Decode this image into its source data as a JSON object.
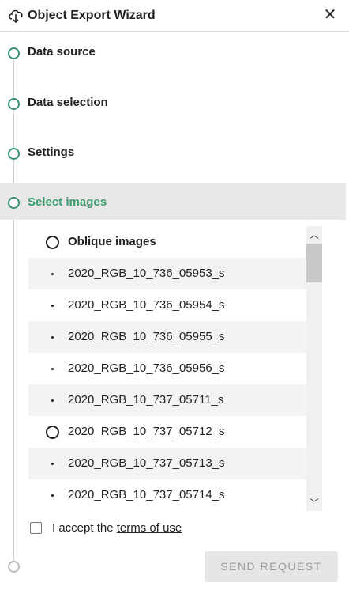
{
  "header": {
    "title": "Object Export Wizard",
    "icon": "download-cloud-icon",
    "close_label": "✕"
  },
  "steps": [
    {
      "label": "Data source"
    },
    {
      "label": "Data selection"
    },
    {
      "label": "Settings"
    },
    {
      "label": "Select images"
    }
  ],
  "image_list": {
    "group": "Oblique images",
    "items": [
      "2020_RGB_10_736_05953_s",
      "2020_RGB_10_736_05954_s",
      "2020_RGB_10_736_05955_s",
      "2020_RGB_10_736_05956_s",
      "2020_RGB_10_737_05711_s",
      "2020_RGB_10_737_05712_s",
      "2020_RGB_10_737_05713_s",
      "2020_RGB_10_737_05714_s"
    ]
  },
  "scroll": {
    "up": "︿",
    "down": "﹀"
  },
  "terms": {
    "prefix": "I accept the ",
    "link": "terms of use"
  },
  "send_button": "SEND REQUEST",
  "colors": {
    "accent": "#3a9a6e",
    "active_bg": "#e8e8e8",
    "disabled_text": "#9a9a9a"
  }
}
